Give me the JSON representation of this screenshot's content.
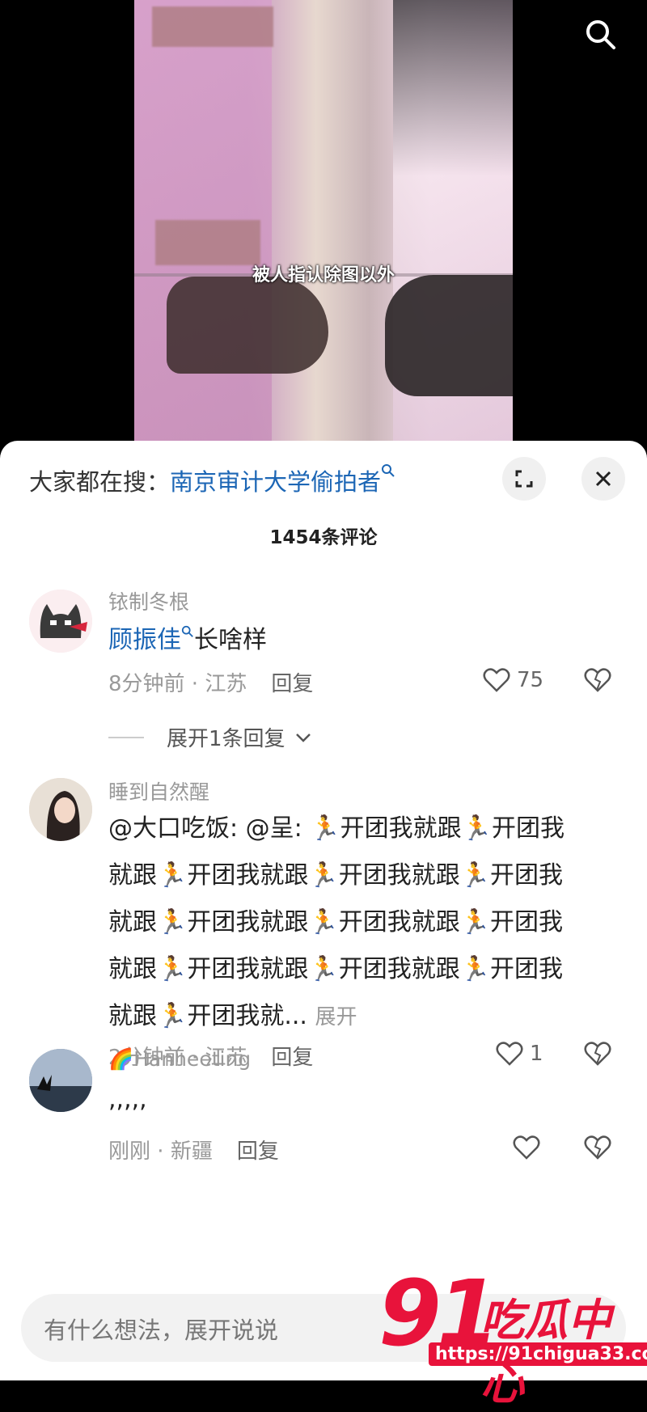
{
  "video": {
    "subtitle": "被人指认除图以外"
  },
  "hot_search": {
    "prefix": "大家都在搜：",
    "term": "南京审计大学偷拍者"
  },
  "comments_count": "1454条评论",
  "comments": [
    {
      "username": "铱制冬根",
      "mention": "顾振佳",
      "text": "长啥样",
      "time": "8分钟前",
      "location": "江苏",
      "reply_label": "回复",
      "likes": "75",
      "expand_replies": "展开1条回复"
    },
    {
      "username": "睡到自然醒",
      "text_lines": [
        "@大口吃饭: @呈: 🏃开团我就跟🏃开团我",
        "就跟🏃开团我就跟🏃开团我就跟🏃开团我",
        "就跟🏃开团我就跟🏃开团我就跟🏃开团我",
        "就跟🏃开团我就跟🏃开团我就跟🏃开团我",
        "就跟🏃开团我就..."
      ],
      "more_label": "展开",
      "time": "2分钟前",
      "location": "江苏",
      "reply_label": "回复",
      "likes": "1"
    },
    {
      "username": "🌈Hanheeting",
      "text": ",,,,,",
      "time": "刚刚",
      "location": "新疆",
      "reply_label": "回复",
      "likes": ""
    }
  ],
  "input": {
    "placeholder": "有什么想法，展开说说"
  },
  "watermark": {
    "number": "91",
    "name": "吃瓜中心",
    "url": "https://91chigua33.com"
  },
  "colors": {
    "link": "#1c66b5",
    "watermark": "#e8133b"
  }
}
